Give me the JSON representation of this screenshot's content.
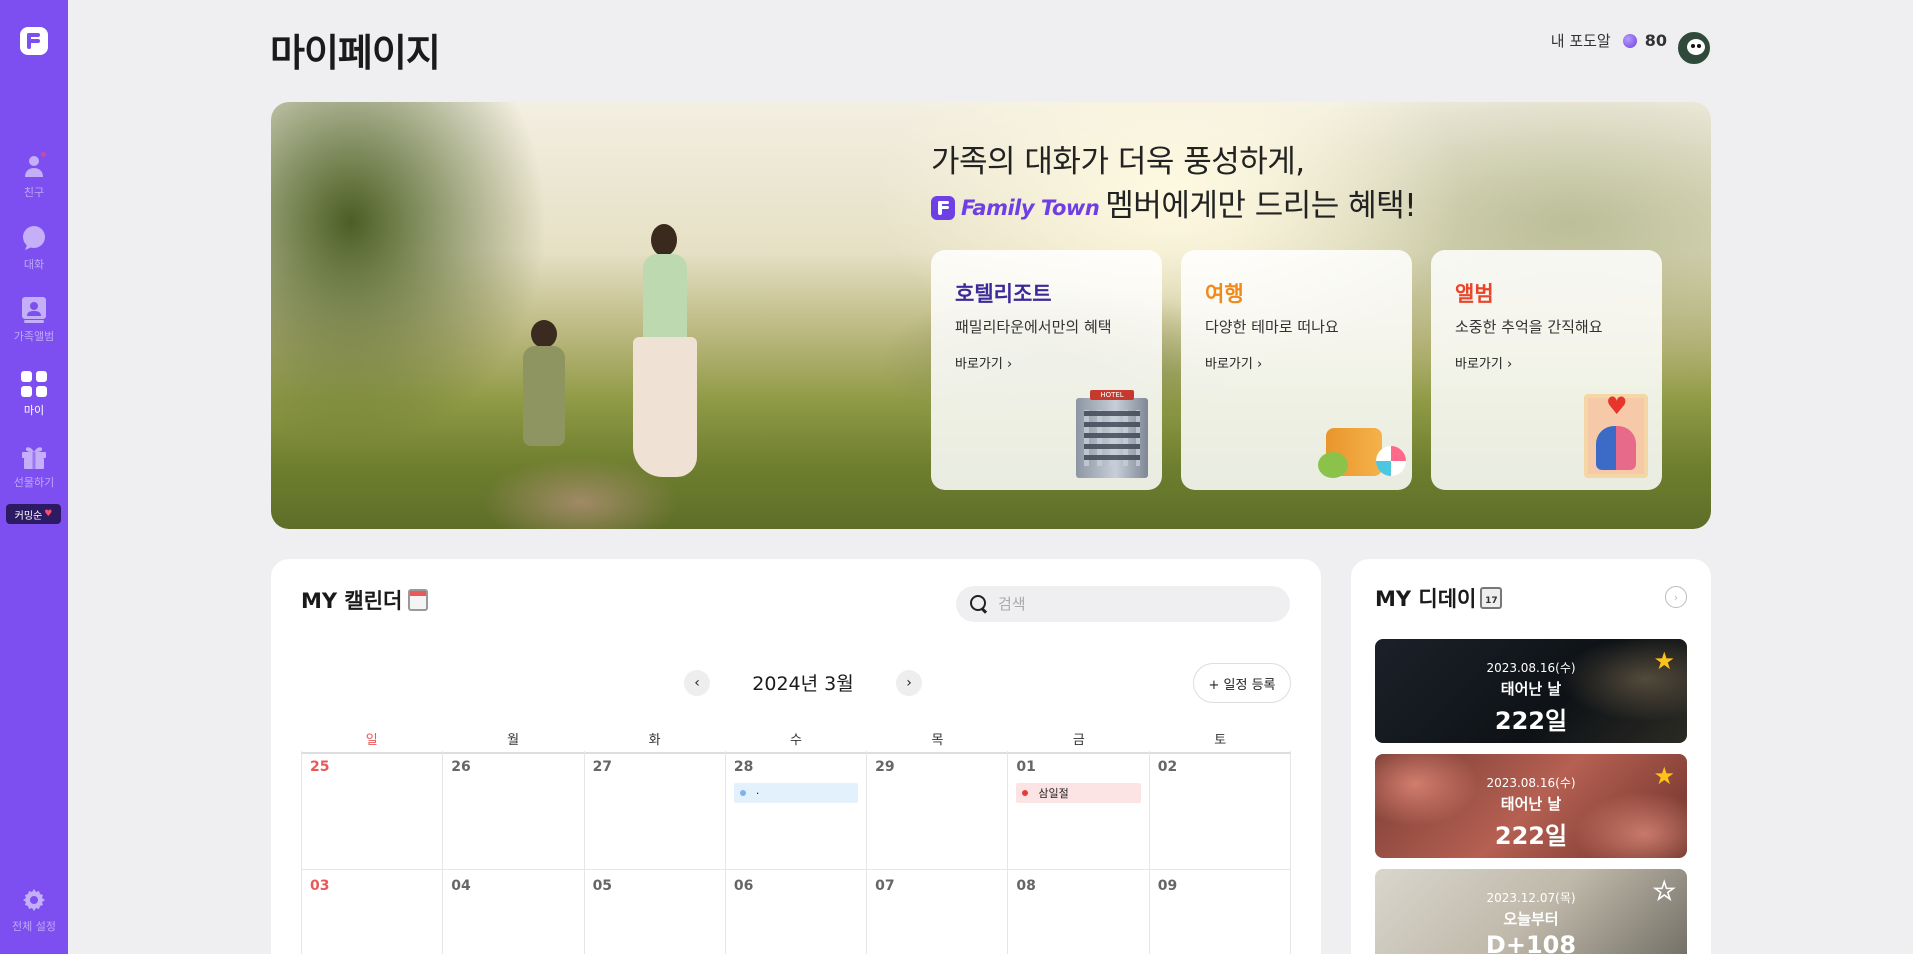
{
  "app": {
    "name": "Family Town"
  },
  "sidebar": {
    "items": [
      {
        "label": "친구",
        "icon": "person-icon"
      },
      {
        "label": "대화",
        "icon": "chat-bubble-icon"
      },
      {
        "label": "가족앨범",
        "icon": "family-album-icon"
      },
      {
        "label": "마이",
        "icon": "grid-icon"
      },
      {
        "label": "선물하기",
        "icon": "gift-icon"
      }
    ],
    "coming_soon": "커밍순",
    "settings_label": "전체 설정"
  },
  "header": {
    "title": "마이페이지",
    "egg_label": "내 포도알",
    "egg_count": "80"
  },
  "banner": {
    "line1": "가족의 대화가 더욱 풍성하게,",
    "brand": "Family Town",
    "line2": "멤버에게만 드리는 혜택!",
    "cards": [
      {
        "title": "호텔리조트",
        "desc": "패밀리타운에서만의 혜택",
        "link": "바로가기"
      },
      {
        "title": "여행",
        "desc": "다양한 테마로 떠나요",
        "link": "바로가기"
      },
      {
        "title": "앨범",
        "desc": "소중한 추억을 간직해요",
        "link": "바로가기"
      }
    ],
    "hotel_sign": "HOTEL"
  },
  "calendar": {
    "title": "MY 캘린더",
    "search_placeholder": "검색",
    "month": "2024년 3월",
    "add_label": "+ 일정 등록",
    "weekdays": [
      "일",
      "월",
      "화",
      "수",
      "목",
      "금",
      "토"
    ],
    "days": [
      "25",
      "26",
      "27",
      "28",
      "29",
      "01",
      "02",
      "03",
      "04",
      "05",
      "06",
      "07",
      "08",
      "09"
    ],
    "events": [
      {
        "label": "·",
        "color": "#7fb2ee",
        "bg": "#e3f1fd"
      },
      {
        "label": "삼일절",
        "color": "#e83a3a",
        "bg": "#fde4e4"
      }
    ]
  },
  "dday": {
    "title": "MY 디데이",
    "cards": [
      {
        "date": "2023.08.16(수)",
        "name": "태어난 날",
        "count": "222일"
      },
      {
        "date": "2023.08.16(수)",
        "name": "태어난 날",
        "count": "222일"
      },
      {
        "date": "2023.12.07(목)",
        "name": "오늘부터",
        "count": "D+108"
      }
    ]
  }
}
